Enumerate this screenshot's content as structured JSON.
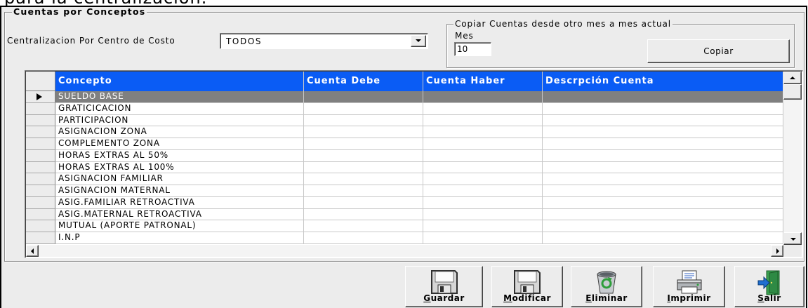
{
  "header_caption": "para la centralización.",
  "form": {
    "group_title": "Cuentas por Conceptos",
    "centro_costo": {
      "label": "Centralizacion Por Centro de Costo",
      "value": "TODOS"
    },
    "copy": {
      "title": "Copiar Cuentas desde otro mes a mes actual",
      "mes_label": "Mes",
      "mes_value": "10",
      "button": "Copiar"
    }
  },
  "grid": {
    "columns": [
      "Concepto",
      "Cuenta Debe",
      "Cuenta Haber",
      "Descrpción Cuenta"
    ],
    "selected_row": 0,
    "rows": [
      [
        "SUELDO BASE",
        "",
        "",
        ""
      ],
      [
        "GRATICICACION",
        "",
        "",
        ""
      ],
      [
        "PARTICIPACION",
        "",
        "",
        ""
      ],
      [
        "ASIGNACION ZONA",
        "",
        "",
        ""
      ],
      [
        "COMPLEMENTO ZONA",
        "",
        "",
        ""
      ],
      [
        "HORAS EXTRAS AL 50%",
        "",
        "",
        ""
      ],
      [
        "HORAS EXTRAS AL 100%",
        "",
        "",
        ""
      ],
      [
        "ASIGNACION FAMILIAR",
        "",
        "",
        ""
      ],
      [
        "ASIGNACION MATERNAL",
        "",
        "",
        ""
      ],
      [
        "ASIG.FAMILIAR RETROACTIVA",
        "",
        "",
        ""
      ],
      [
        "ASIG.MATERNAL RETROACTIVA",
        "",
        "",
        ""
      ],
      [
        "MUTUAL (APORTE PATRONAL)",
        "",
        "",
        ""
      ],
      [
        "I.N.P",
        "",
        "",
        ""
      ]
    ]
  },
  "toolbar": {
    "buttons": [
      {
        "label": "Guardar",
        "icon": "floppy-disk-icon"
      },
      {
        "label": "Modificar",
        "icon": "floppy-disk-icon"
      },
      {
        "label": "Eliminar",
        "icon": "recycle-bin-icon"
      },
      {
        "label": "Imprimir",
        "icon": "printer-icon"
      },
      {
        "label": "Salir",
        "icon": "exit-door-icon"
      }
    ]
  },
  "colors": {
    "form_bg": "#ececec",
    "grid_header_bg": "#0a5cf5",
    "grid_header_text": "#ffffff",
    "selected_row_bg": "#808080",
    "selected_row_text": "#ffffff"
  }
}
